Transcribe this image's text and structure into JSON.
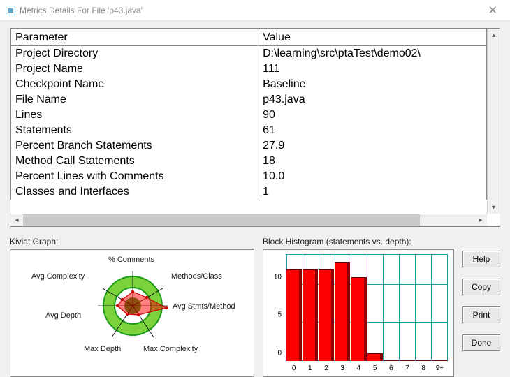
{
  "window": {
    "title": "Metrics Details For File 'p43.java'"
  },
  "table": {
    "headers": {
      "param": "Parameter",
      "value": "Value"
    },
    "rows": [
      {
        "param": "Project Directory",
        "value": "D:\\learning\\src\\ptaTest\\demo02\\"
      },
      {
        "param": "Project Name",
        "value": "111"
      },
      {
        "param": "Checkpoint Name",
        "value": "Baseline"
      },
      {
        "param": "File Name",
        "value": "p43.java"
      },
      {
        "param": "Lines",
        "value": "90"
      },
      {
        "param": "Statements",
        "value": "61"
      },
      {
        "param": "Percent Branch Statements",
        "value": "27.9"
      },
      {
        "param": "Method Call Statements",
        "value": "18"
      },
      {
        "param": "Percent Lines with Comments",
        "value": "10.0"
      },
      {
        "param": "Classes and Interfaces",
        "value": "1"
      }
    ]
  },
  "kiviat": {
    "label": "Kiviat Graph:",
    "axes": {
      "top": "% Comments",
      "top_right": "Methods/Class",
      "right": "Avg Stmts/Method",
      "bottom_right": "Max Complexity",
      "bottom_left": "Max Depth",
      "left": "Avg Depth",
      "top_left": "Avg Complexity"
    }
  },
  "histogram": {
    "label": "Block Histogram (statements vs. depth):"
  },
  "chart_data": {
    "type": "bar",
    "categories": [
      "0",
      "1",
      "2",
      "3",
      "4",
      "5",
      "6",
      "7",
      "8",
      "9+"
    ],
    "values": [
      12,
      12,
      12,
      13,
      11,
      1,
      0,
      0,
      0,
      0
    ],
    "xlabel": "depth",
    "ylabel": "statements",
    "yticks": [
      0,
      5,
      10
    ],
    "ylim": [
      0,
      14
    ]
  },
  "buttons": {
    "help": "Help",
    "copy": "Copy",
    "print": "Print",
    "done": "Done"
  }
}
